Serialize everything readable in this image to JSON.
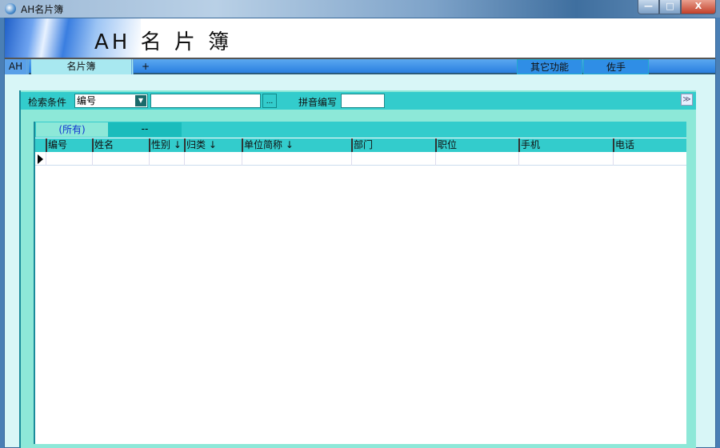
{
  "window": {
    "title": "AH名片簿",
    "min_icon": "minimize-icon",
    "max_icon": "maximize-icon",
    "close_icon": "close-icon",
    "min": "—",
    "max": "□",
    "close": "X"
  },
  "banner": {
    "title": "AH 名 片 簿"
  },
  "tabs": {
    "ah": "AH",
    "card": "名片簿",
    "plus": "+",
    "other": "其它功能",
    "assist": "佐手"
  },
  "search": {
    "cond_label": "检索条件",
    "cond_value": "编号",
    "browse": "...",
    "pinyin_label": "拼音编写",
    "collapse": "≫"
  },
  "grid": {
    "tabs": [
      "(所有)",
      "--"
    ],
    "columns": [
      "编号",
      "姓名",
      "性别 ↓",
      "归类 ↓",
      "单位简称 ↓",
      "部门",
      "职位",
      "手机",
      "电话"
    ]
  }
}
